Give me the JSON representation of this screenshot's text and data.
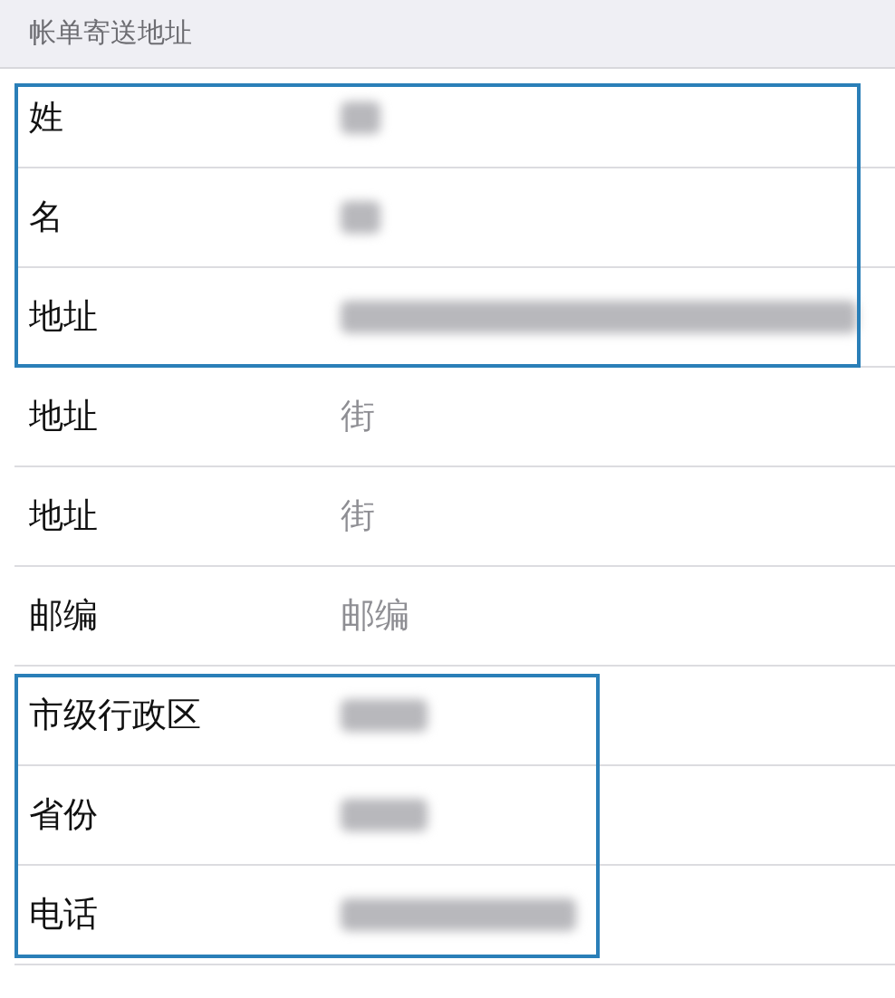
{
  "section_header": "帐单寄送地址",
  "groups": [
    {
      "kind": "boxed_wide",
      "rows": [
        {
          "label": "姓",
          "kind": "blur_short"
        },
        {
          "label": "名",
          "kind": "blur_short"
        },
        {
          "label": "地址",
          "kind": "blur_xlong"
        }
      ]
    },
    {
      "kind": "plain",
      "rows": [
        {
          "label": "地址",
          "kind": "field",
          "placeholder": "街"
        },
        {
          "label": "地址",
          "kind": "field",
          "placeholder": "街"
        },
        {
          "label": "邮编",
          "kind": "field",
          "placeholder": "邮编"
        }
      ]
    },
    {
      "kind": "boxed_narrow",
      "rows": [
        {
          "label": "市级行政区",
          "kind": "blur_medium"
        },
        {
          "label": "省份",
          "kind": "blur_medium"
        },
        {
          "label": "电话",
          "kind": "blur_long"
        }
      ]
    }
  ]
}
